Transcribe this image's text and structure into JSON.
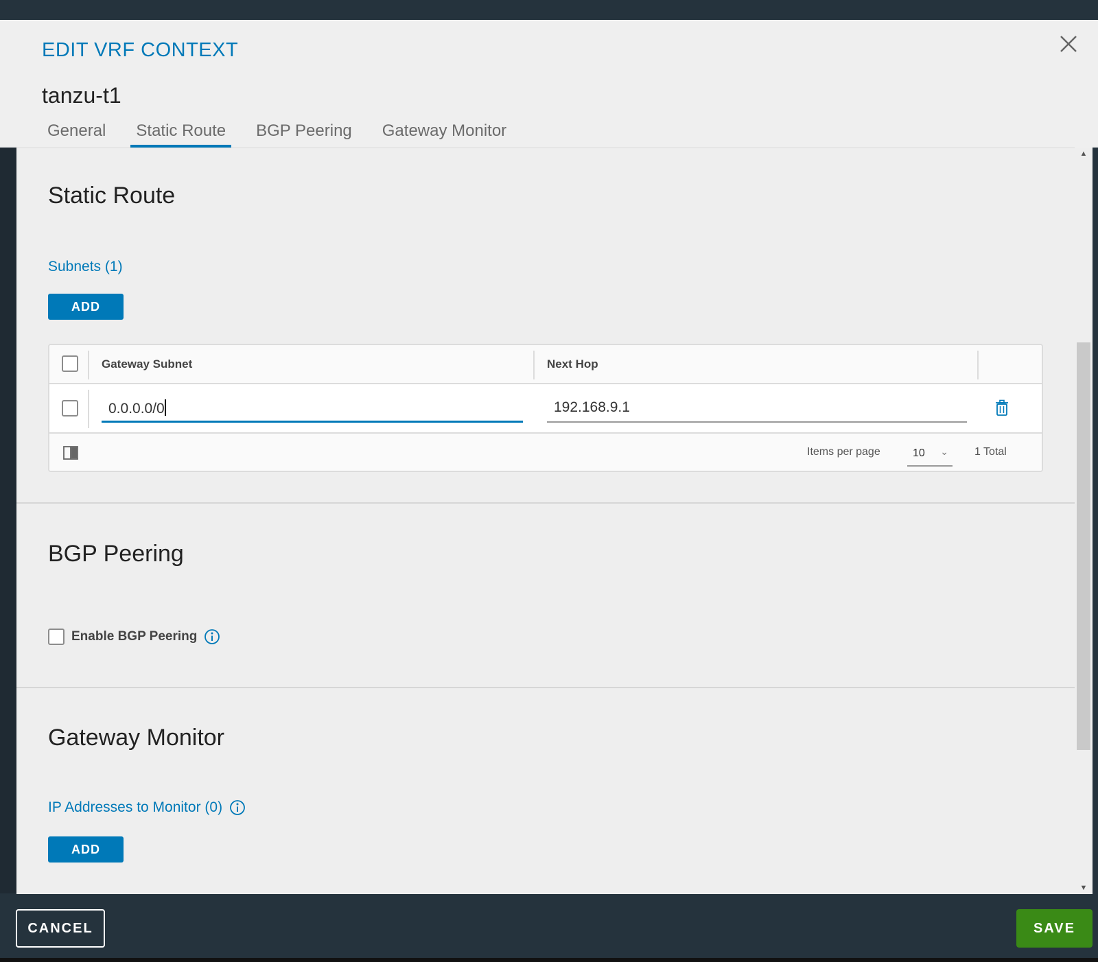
{
  "modal": {
    "title": "EDIT VRF CONTEXT",
    "subtitle": "tanzu-t1",
    "close_icon": "close-icon"
  },
  "tabs": [
    {
      "label": "General",
      "active": false
    },
    {
      "label": "Static Route",
      "active": true
    },
    {
      "label": "BGP Peering",
      "active": false
    },
    {
      "label": "Gateway Monitor",
      "active": false
    }
  ],
  "static_route": {
    "title": "Static Route",
    "subnets_label": "Subnets (1)",
    "add_label": "ADD",
    "grid": {
      "columns": [
        "Gateway Subnet",
        "Next Hop"
      ],
      "rows": [
        {
          "gateway_subnet": "0.0.0.0/0",
          "next_hop": "192.168.9.1"
        }
      ],
      "items_per_page_label": "Items per page",
      "items_per_page_value": "10",
      "total_label": "1 Total"
    }
  },
  "bgp_peering": {
    "title": "BGP Peering",
    "enable_label": "Enable BGP Peering",
    "enabled": false
  },
  "gateway_monitor": {
    "title": "Gateway Monitor",
    "ip_label": "IP Addresses to Monitor (0)",
    "add_label": "ADD"
  },
  "footer": {
    "cancel_label": "CANCEL",
    "save_label": "SAVE"
  },
  "colors": {
    "accent": "#0079b8",
    "save": "#3a8a16",
    "dark": "#25333d"
  }
}
